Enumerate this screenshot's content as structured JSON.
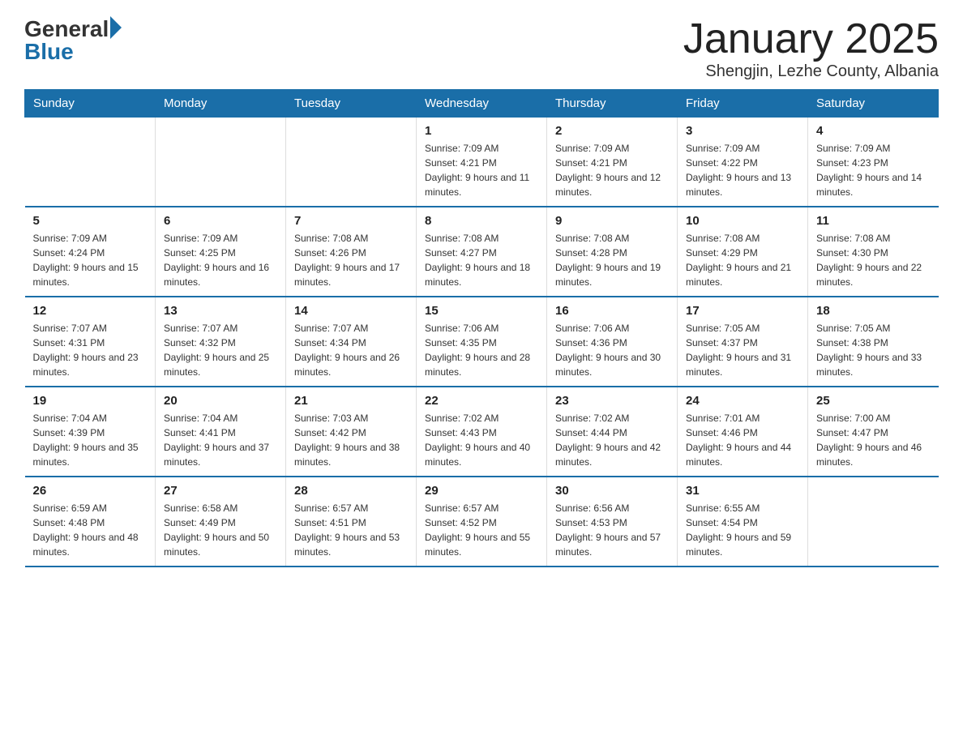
{
  "header": {
    "logo_general": "General",
    "logo_blue": "Blue",
    "month_title": "January 2025",
    "location": "Shengjin, Lezhe County, Albania"
  },
  "days_of_week": [
    "Sunday",
    "Monday",
    "Tuesday",
    "Wednesday",
    "Thursday",
    "Friday",
    "Saturday"
  ],
  "weeks": [
    [
      {
        "day": "",
        "sunrise": "",
        "sunset": "",
        "daylight": ""
      },
      {
        "day": "",
        "sunrise": "",
        "sunset": "",
        "daylight": ""
      },
      {
        "day": "",
        "sunrise": "",
        "sunset": "",
        "daylight": ""
      },
      {
        "day": "1",
        "sunrise": "Sunrise: 7:09 AM",
        "sunset": "Sunset: 4:21 PM",
        "daylight": "Daylight: 9 hours and 11 minutes."
      },
      {
        "day": "2",
        "sunrise": "Sunrise: 7:09 AM",
        "sunset": "Sunset: 4:21 PM",
        "daylight": "Daylight: 9 hours and 12 minutes."
      },
      {
        "day": "3",
        "sunrise": "Sunrise: 7:09 AM",
        "sunset": "Sunset: 4:22 PM",
        "daylight": "Daylight: 9 hours and 13 minutes."
      },
      {
        "day": "4",
        "sunrise": "Sunrise: 7:09 AM",
        "sunset": "Sunset: 4:23 PM",
        "daylight": "Daylight: 9 hours and 14 minutes."
      }
    ],
    [
      {
        "day": "5",
        "sunrise": "Sunrise: 7:09 AM",
        "sunset": "Sunset: 4:24 PM",
        "daylight": "Daylight: 9 hours and 15 minutes."
      },
      {
        "day": "6",
        "sunrise": "Sunrise: 7:09 AM",
        "sunset": "Sunset: 4:25 PM",
        "daylight": "Daylight: 9 hours and 16 minutes."
      },
      {
        "day": "7",
        "sunrise": "Sunrise: 7:08 AM",
        "sunset": "Sunset: 4:26 PM",
        "daylight": "Daylight: 9 hours and 17 minutes."
      },
      {
        "day": "8",
        "sunrise": "Sunrise: 7:08 AM",
        "sunset": "Sunset: 4:27 PM",
        "daylight": "Daylight: 9 hours and 18 minutes."
      },
      {
        "day": "9",
        "sunrise": "Sunrise: 7:08 AM",
        "sunset": "Sunset: 4:28 PM",
        "daylight": "Daylight: 9 hours and 19 minutes."
      },
      {
        "day": "10",
        "sunrise": "Sunrise: 7:08 AM",
        "sunset": "Sunset: 4:29 PM",
        "daylight": "Daylight: 9 hours and 21 minutes."
      },
      {
        "day": "11",
        "sunrise": "Sunrise: 7:08 AM",
        "sunset": "Sunset: 4:30 PM",
        "daylight": "Daylight: 9 hours and 22 minutes."
      }
    ],
    [
      {
        "day": "12",
        "sunrise": "Sunrise: 7:07 AM",
        "sunset": "Sunset: 4:31 PM",
        "daylight": "Daylight: 9 hours and 23 minutes."
      },
      {
        "day": "13",
        "sunrise": "Sunrise: 7:07 AM",
        "sunset": "Sunset: 4:32 PM",
        "daylight": "Daylight: 9 hours and 25 minutes."
      },
      {
        "day": "14",
        "sunrise": "Sunrise: 7:07 AM",
        "sunset": "Sunset: 4:34 PM",
        "daylight": "Daylight: 9 hours and 26 minutes."
      },
      {
        "day": "15",
        "sunrise": "Sunrise: 7:06 AM",
        "sunset": "Sunset: 4:35 PM",
        "daylight": "Daylight: 9 hours and 28 minutes."
      },
      {
        "day": "16",
        "sunrise": "Sunrise: 7:06 AM",
        "sunset": "Sunset: 4:36 PM",
        "daylight": "Daylight: 9 hours and 30 minutes."
      },
      {
        "day": "17",
        "sunrise": "Sunrise: 7:05 AM",
        "sunset": "Sunset: 4:37 PM",
        "daylight": "Daylight: 9 hours and 31 minutes."
      },
      {
        "day": "18",
        "sunrise": "Sunrise: 7:05 AM",
        "sunset": "Sunset: 4:38 PM",
        "daylight": "Daylight: 9 hours and 33 minutes."
      }
    ],
    [
      {
        "day": "19",
        "sunrise": "Sunrise: 7:04 AM",
        "sunset": "Sunset: 4:39 PM",
        "daylight": "Daylight: 9 hours and 35 minutes."
      },
      {
        "day": "20",
        "sunrise": "Sunrise: 7:04 AM",
        "sunset": "Sunset: 4:41 PM",
        "daylight": "Daylight: 9 hours and 37 minutes."
      },
      {
        "day": "21",
        "sunrise": "Sunrise: 7:03 AM",
        "sunset": "Sunset: 4:42 PM",
        "daylight": "Daylight: 9 hours and 38 minutes."
      },
      {
        "day": "22",
        "sunrise": "Sunrise: 7:02 AM",
        "sunset": "Sunset: 4:43 PM",
        "daylight": "Daylight: 9 hours and 40 minutes."
      },
      {
        "day": "23",
        "sunrise": "Sunrise: 7:02 AM",
        "sunset": "Sunset: 4:44 PM",
        "daylight": "Daylight: 9 hours and 42 minutes."
      },
      {
        "day": "24",
        "sunrise": "Sunrise: 7:01 AM",
        "sunset": "Sunset: 4:46 PM",
        "daylight": "Daylight: 9 hours and 44 minutes."
      },
      {
        "day": "25",
        "sunrise": "Sunrise: 7:00 AM",
        "sunset": "Sunset: 4:47 PM",
        "daylight": "Daylight: 9 hours and 46 minutes."
      }
    ],
    [
      {
        "day": "26",
        "sunrise": "Sunrise: 6:59 AM",
        "sunset": "Sunset: 4:48 PM",
        "daylight": "Daylight: 9 hours and 48 minutes."
      },
      {
        "day": "27",
        "sunrise": "Sunrise: 6:58 AM",
        "sunset": "Sunset: 4:49 PM",
        "daylight": "Daylight: 9 hours and 50 minutes."
      },
      {
        "day": "28",
        "sunrise": "Sunrise: 6:57 AM",
        "sunset": "Sunset: 4:51 PM",
        "daylight": "Daylight: 9 hours and 53 minutes."
      },
      {
        "day": "29",
        "sunrise": "Sunrise: 6:57 AM",
        "sunset": "Sunset: 4:52 PM",
        "daylight": "Daylight: 9 hours and 55 minutes."
      },
      {
        "day": "30",
        "sunrise": "Sunrise: 6:56 AM",
        "sunset": "Sunset: 4:53 PM",
        "daylight": "Daylight: 9 hours and 57 minutes."
      },
      {
        "day": "31",
        "sunrise": "Sunrise: 6:55 AM",
        "sunset": "Sunset: 4:54 PM",
        "daylight": "Daylight: 9 hours and 59 minutes."
      },
      {
        "day": "",
        "sunrise": "",
        "sunset": "",
        "daylight": ""
      }
    ]
  ]
}
